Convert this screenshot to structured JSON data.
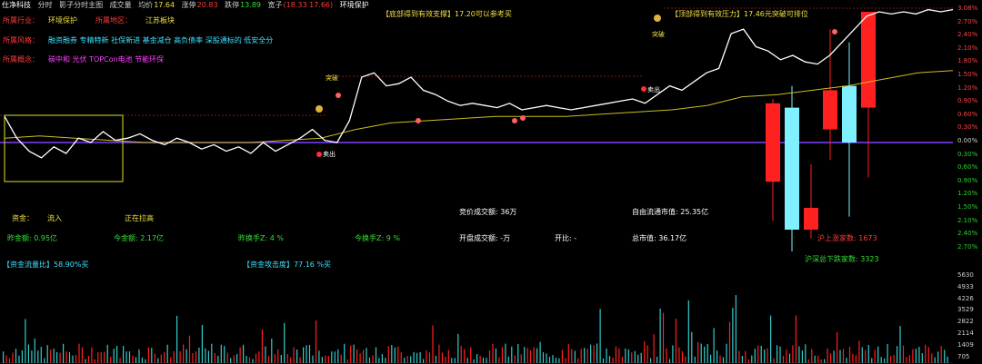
{
  "header": {
    "stock_name": "仕净科技",
    "menu": [
      "分时",
      "影子分时主图",
      "成交量"
    ],
    "avg_label": "均价",
    "avg_value": "17.64",
    "up_label": "涨停",
    "up_value": "20.83",
    "down_label": "跌停",
    "down_value": "13.89",
    "area_label": "宽子",
    "area_value": "(18.33 17.66)",
    "tag": "环境保护"
  },
  "info": {
    "industry_label": "所属行业：",
    "industry_value": "环境保护",
    "region_label": "所属地区：",
    "region_value": "江苏板块",
    "style_label": "所属风格：",
    "style_value": "融资融券 专精特新 社保新进 基金减仓 高负债率 深股通标的 低安全分",
    "concept_label": "所属概念：",
    "concept_value": "碳中和 光伏 TOPCon电池 节能环保"
  },
  "notes": {
    "support": "【底部得到有效支撑】17.20可以参考买",
    "pressure": "【顶部得到有效压力】17.46元突破可排位"
  },
  "markers": {
    "break_1": "突破",
    "break_2": "突破",
    "sell_1": "卖出",
    "sell_2": "卖出"
  },
  "stats": {
    "fund_label": "资金：",
    "fund_in": "流入",
    "fund_state": "正在拉高",
    "bid_amount": "竞价成交额: 36万",
    "float_mv": "自由流通市值: 25.35亿",
    "yesterday_amt": "昨金额: 0.95亿",
    "today_amt": "今金额: 2.17亿",
    "yday_turnover": "昨换手Z: 4 %",
    "today_turnover": "今换手Z: 9 %",
    "open_amount": "开盘成交额: -万",
    "open_ratio": "开比: -",
    "total_mv": "总市值: 36.17亿",
    "fund_flow": "【资金流量比】58.90%买",
    "fund_attack": "【资金攻击度】77.16 %买",
    "sh_up": "沪上涨家数: 1673",
    "sh_down": "沪深总下跌家数: 3323"
  },
  "right_axis": {
    "pct_labels": [
      "3.08%",
      "2.70%",
      "2.40%",
      "2.10%",
      "1.80%",
      "1.50%",
      "1.20%",
      "0.90%",
      "0.60%",
      "0.30%",
      "0.00%",
      "0.30%",
      "0.60%",
      "0.90%",
      "1.20%",
      "1.50%",
      "2.10%",
      "2.40%",
      "2.70%"
    ],
    "vol_labels": [
      "5630",
      "4933",
      "4226",
      "3529",
      "2822",
      "2114",
      "1409",
      "705"
    ]
  },
  "colors": {
    "price": "#ffffff",
    "avg": "#c8c020",
    "zero_line": "#8040ff",
    "rise": "#ff2020",
    "fall": "#7ff0ff",
    "box": "#e0e020"
  },
  "chart_data": {
    "type": "line",
    "price_pct_samples": [
      0.6,
      0.1,
      -0.2,
      -0.35,
      -0.1,
      -0.25,
      0.1,
      0.0,
      0.25,
      0.05,
      0.1,
      0.2,
      0.05,
      -0.05,
      0.1,
      0.0,
      -0.15,
      -0.05,
      -0.2,
      -0.1,
      -0.25,
      0.0,
      -0.2,
      -0.05,
      0.1,
      0.3,
      0.05,
      0.0,
      0.5,
      1.5,
      1.6,
      1.3,
      1.35,
      1.5,
      1.2,
      1.1,
      0.95,
      0.85,
      0.9,
      0.85,
      0.8,
      0.9,
      0.75,
      0.8,
      0.85,
      0.8,
      0.75,
      0.8,
      0.85,
      0.9,
      0.95,
      1.0,
      0.9,
      1.1,
      1.3,
      1.2,
      1.4,
      1.6,
      1.7,
      2.5,
      2.6,
      2.2,
      2.1,
      1.9,
      2.0,
      1.85,
      1.8,
      2.0,
      2.3,
      2.6,
      2.9,
      3.0,
      2.95,
      3.0,
      2.95,
      3.05,
      3.0,
      3.05
    ],
    "avg_pct_samples": [
      0.1,
      0.15,
      0.1,
      0.05,
      0.0,
      0.0,
      0.0,
      0.0,
      0.05,
      0.1,
      0.3,
      0.45,
      0.5,
      0.55,
      0.6,
      0.6,
      0.6,
      0.65,
      0.7,
      0.75,
      0.85,
      1.05,
      1.1,
      1.2,
      1.3,
      1.45,
      1.6,
      1.65
    ],
    "candles": [
      {
        "open": 0.9,
        "close": -0.9,
        "high": 1.0,
        "low": -1.8,
        "dir": "rise"
      },
      {
        "open": 0.8,
        "close": -2.0,
        "high": 1.3,
        "low": -2.5,
        "dir": "fall"
      },
      {
        "open": -1.5,
        "close": -2.0,
        "high": -0.5,
        "low": -2.2,
        "dir": "rise"
      },
      {
        "open": 1.2,
        "close": 0.3,
        "high": 2.6,
        "low": -0.4,
        "dir": "rise"
      },
      {
        "open": 1.3,
        "close": 0.0,
        "high": 2.3,
        "low": -1.7,
        "dir": "fall"
      },
      {
        "open": 3.0,
        "close": 0.8,
        "high": 3.0,
        "low": -0.8,
        "dir": "rise"
      }
    ]
  }
}
